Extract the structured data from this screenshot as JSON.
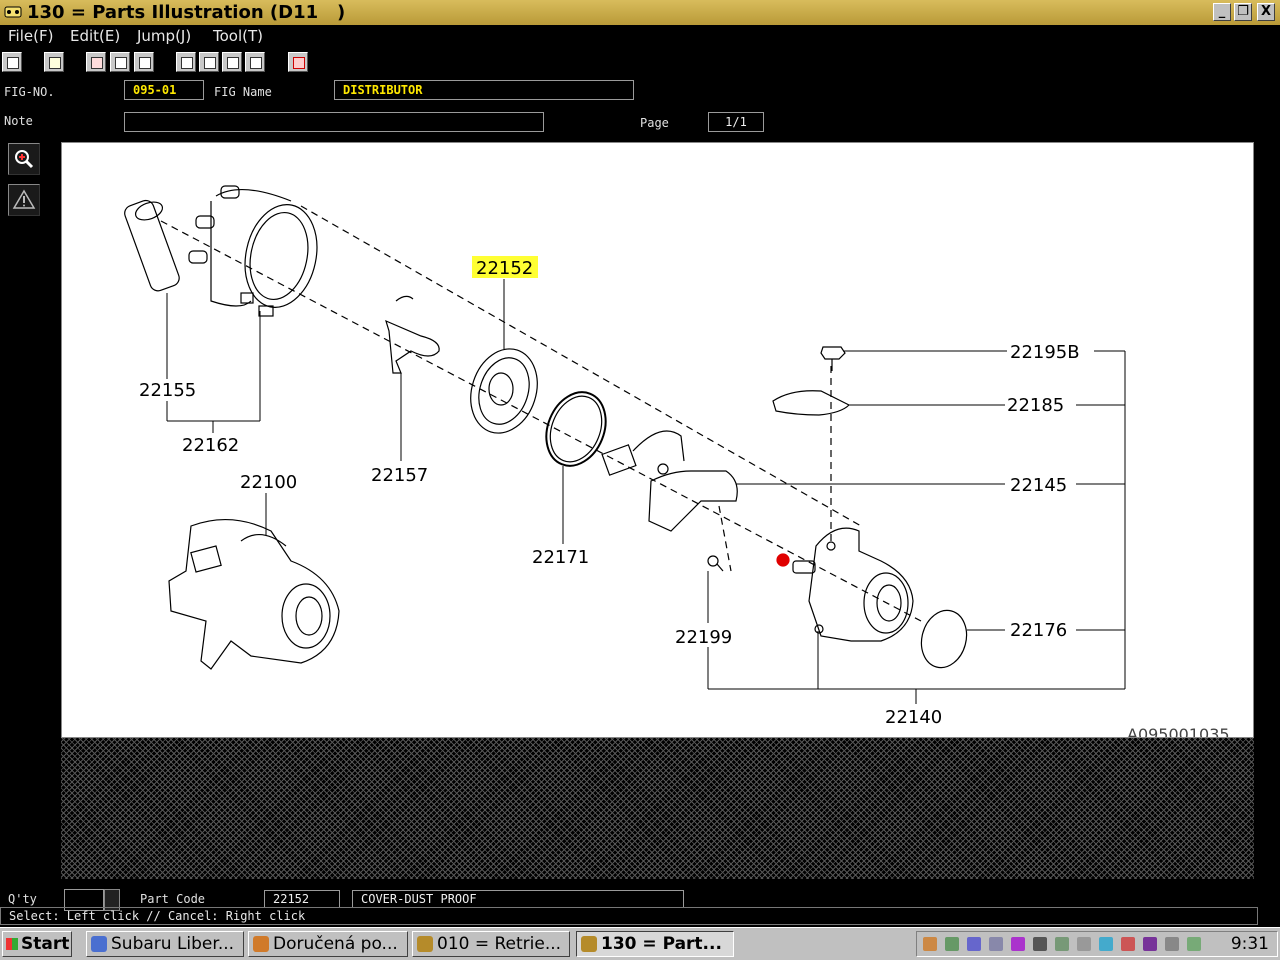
{
  "window": {
    "title": "130 = Parts Illustration (D11   )",
    "minimize_glyph": "_",
    "restore_glyph": "❐",
    "close_glyph": "X"
  },
  "menu": [
    "File(F)",
    "Edit(E)",
    "Jump(J)",
    "Tool(T)"
  ],
  "toolbar_icons": [
    "print-icon",
    "document-icon",
    "copy-icon",
    "copy-alt-icon",
    "sheet-icon",
    "nav-first-icon",
    "nav-prev-icon",
    "nav-next-icon",
    "nav-last-icon",
    "exit-icon"
  ],
  "header": {
    "fig_no_label": "FIG-NO.",
    "fig_no": "095-01",
    "fig_name_label": "FIG Name",
    "fig_name": "DISTRIBUTOR",
    "note_label": "Note",
    "note": "",
    "page_label": "Page",
    "page": "1/1"
  },
  "side_tools": [
    "zoom-in-icon",
    "warning-icon"
  ],
  "illustration": {
    "code": "A095001035",
    "highlighted_part": "22152",
    "callouts": {
      "c22155": "22155",
      "c22162": "22162",
      "c22100": "22100",
      "c22157": "22157",
      "c22152": "22152",
      "c22171": "22171",
      "c22195B": "22195B",
      "c22185": "22185",
      "c22145": "22145",
      "c22199": "22199",
      "c22176": "22176",
      "c22140": "22140"
    }
  },
  "footer": {
    "qty_label": "Q'ty",
    "qty": "",
    "part_code_label": "Part Code",
    "part_code": "22152",
    "part_name": "COVER-DUST PROOF",
    "status": "Select: Left click // Cancel: Right click"
  },
  "taskbar": {
    "start": "Start",
    "tasks": [
      "Subaru Liber...",
      "Doručená po...",
      "010 = Retrie...",
      "130 = Part..."
    ],
    "clock": "9:31"
  },
  "colors": {
    "highlight": "#ffff33",
    "accent": "#ffe800",
    "marker": "#e00000"
  }
}
